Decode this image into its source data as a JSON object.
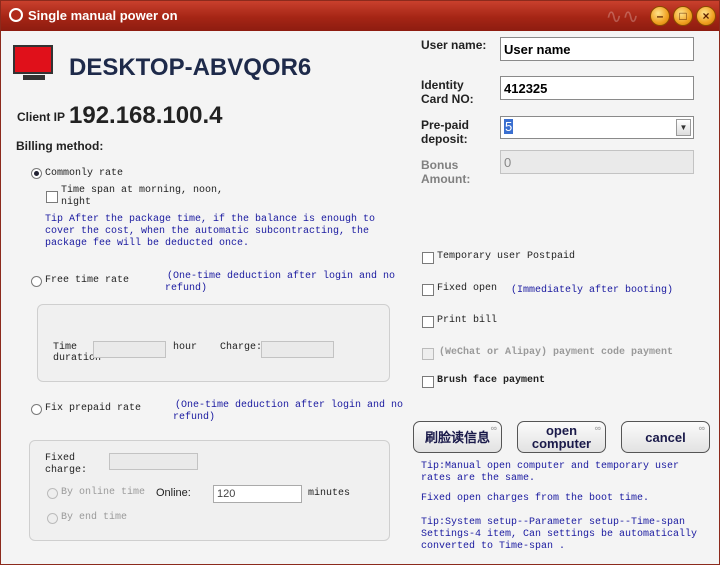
{
  "window": {
    "title": "Single manual power on"
  },
  "client": {
    "name": "DESKTOP-ABVQOR6",
    "ip_label": "Client IP",
    "ip": "192.168.100.4",
    "billing_label": "Billing method:"
  },
  "billing": {
    "commonly_rate": "Commonly rate",
    "time_span": "Time span at morning, noon,",
    "time_span2": "night",
    "tip1": "Tip After the package time, if the balance is enough to",
    "tip2": "cover the cost, when the automatic subcontracting, the",
    "tip3": "package fee will be deducted once.",
    "free_time_rate": "Free time rate",
    "free_note1": "(One-time deduction after login and no",
    "free_note2": "refund)",
    "time_duration1": "Time",
    "time_duration2": "duration",
    "hour": "hour",
    "charge": "Charge:",
    "fix_prepaid_rate": "Fix prepaid rate",
    "fix_note1": "(One-time deduction after login and no",
    "fix_note2": "refund)",
    "fixed_charge1": "Fixed",
    "fixed_charge2": "charge:",
    "by_online_time": "By online time",
    "online_label": "Online:",
    "online_value": "120",
    "minutes": "minutes",
    "by_end_time": "By end time"
  },
  "user": {
    "username_label": "User name:",
    "username_value": "User name",
    "idcard_label1": "Identity",
    "idcard_label2": "Card NO:",
    "idcard_value": "412325",
    "prepaid_label1": "Pre-paid",
    "prepaid_label2": "deposit:",
    "prepaid_value": "5",
    "bonus_label1": "Bonus",
    "bonus_label2": "Amount:",
    "bonus_value": "0"
  },
  "options": {
    "temp_postpaid": "Temporary user Postpaid",
    "fixed_open": "Fixed open",
    "fixed_open_note": "(Immediately after booting)",
    "print_bill": "Print bill",
    "wechat": "(WeChat or Alipay) payment code payment",
    "brush_face": "Brush face payment"
  },
  "buttons": {
    "face_read": "刷脸读信息",
    "open_computer1": "open",
    "open_computer2": "computer",
    "cancel": "cancel"
  },
  "tips": {
    "t1a": "Tip:Manual open computer and temporary user",
    "t1b": "rates are the same.",
    "t2": "Fixed open charges from the boot time.",
    "t3a": "Tip:System setup--Parameter setup--Time-span",
    "t3b": "Settings-4 item, Can settings be automatically",
    "t3c": "converted to Time-span ."
  },
  "colors": {
    "titlebar": "#a52515",
    "monitor": "#e0101a",
    "tip_text": "#1a1aa0"
  }
}
